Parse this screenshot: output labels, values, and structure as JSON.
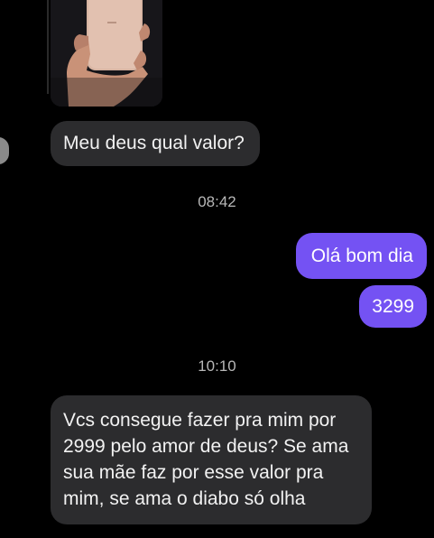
{
  "messages": [
    {
      "type": "image",
      "direction": "incoming",
      "content": "phone-photo"
    },
    {
      "type": "text",
      "direction": "incoming",
      "text": "Meu deus qual valor?"
    },
    {
      "type": "timestamp",
      "text": "08:42"
    },
    {
      "type": "text",
      "direction": "outgoing",
      "text": "Olá bom dia"
    },
    {
      "type": "text",
      "direction": "outgoing",
      "text": "3299"
    },
    {
      "type": "timestamp",
      "text": "10:10"
    },
    {
      "type": "text",
      "direction": "incoming",
      "text": "Vcs consegue fazer pra mim por 2999 pelo amor de deus? Se ama sua mãe faz por esse valor pra mim, se ama o diabo só olha"
    }
  ],
  "colors": {
    "background": "#000000",
    "incoming_bubble": "#2c2c2e",
    "outgoing_bubble": "#7452f3",
    "timestamp_text": "#b8b8b8"
  }
}
